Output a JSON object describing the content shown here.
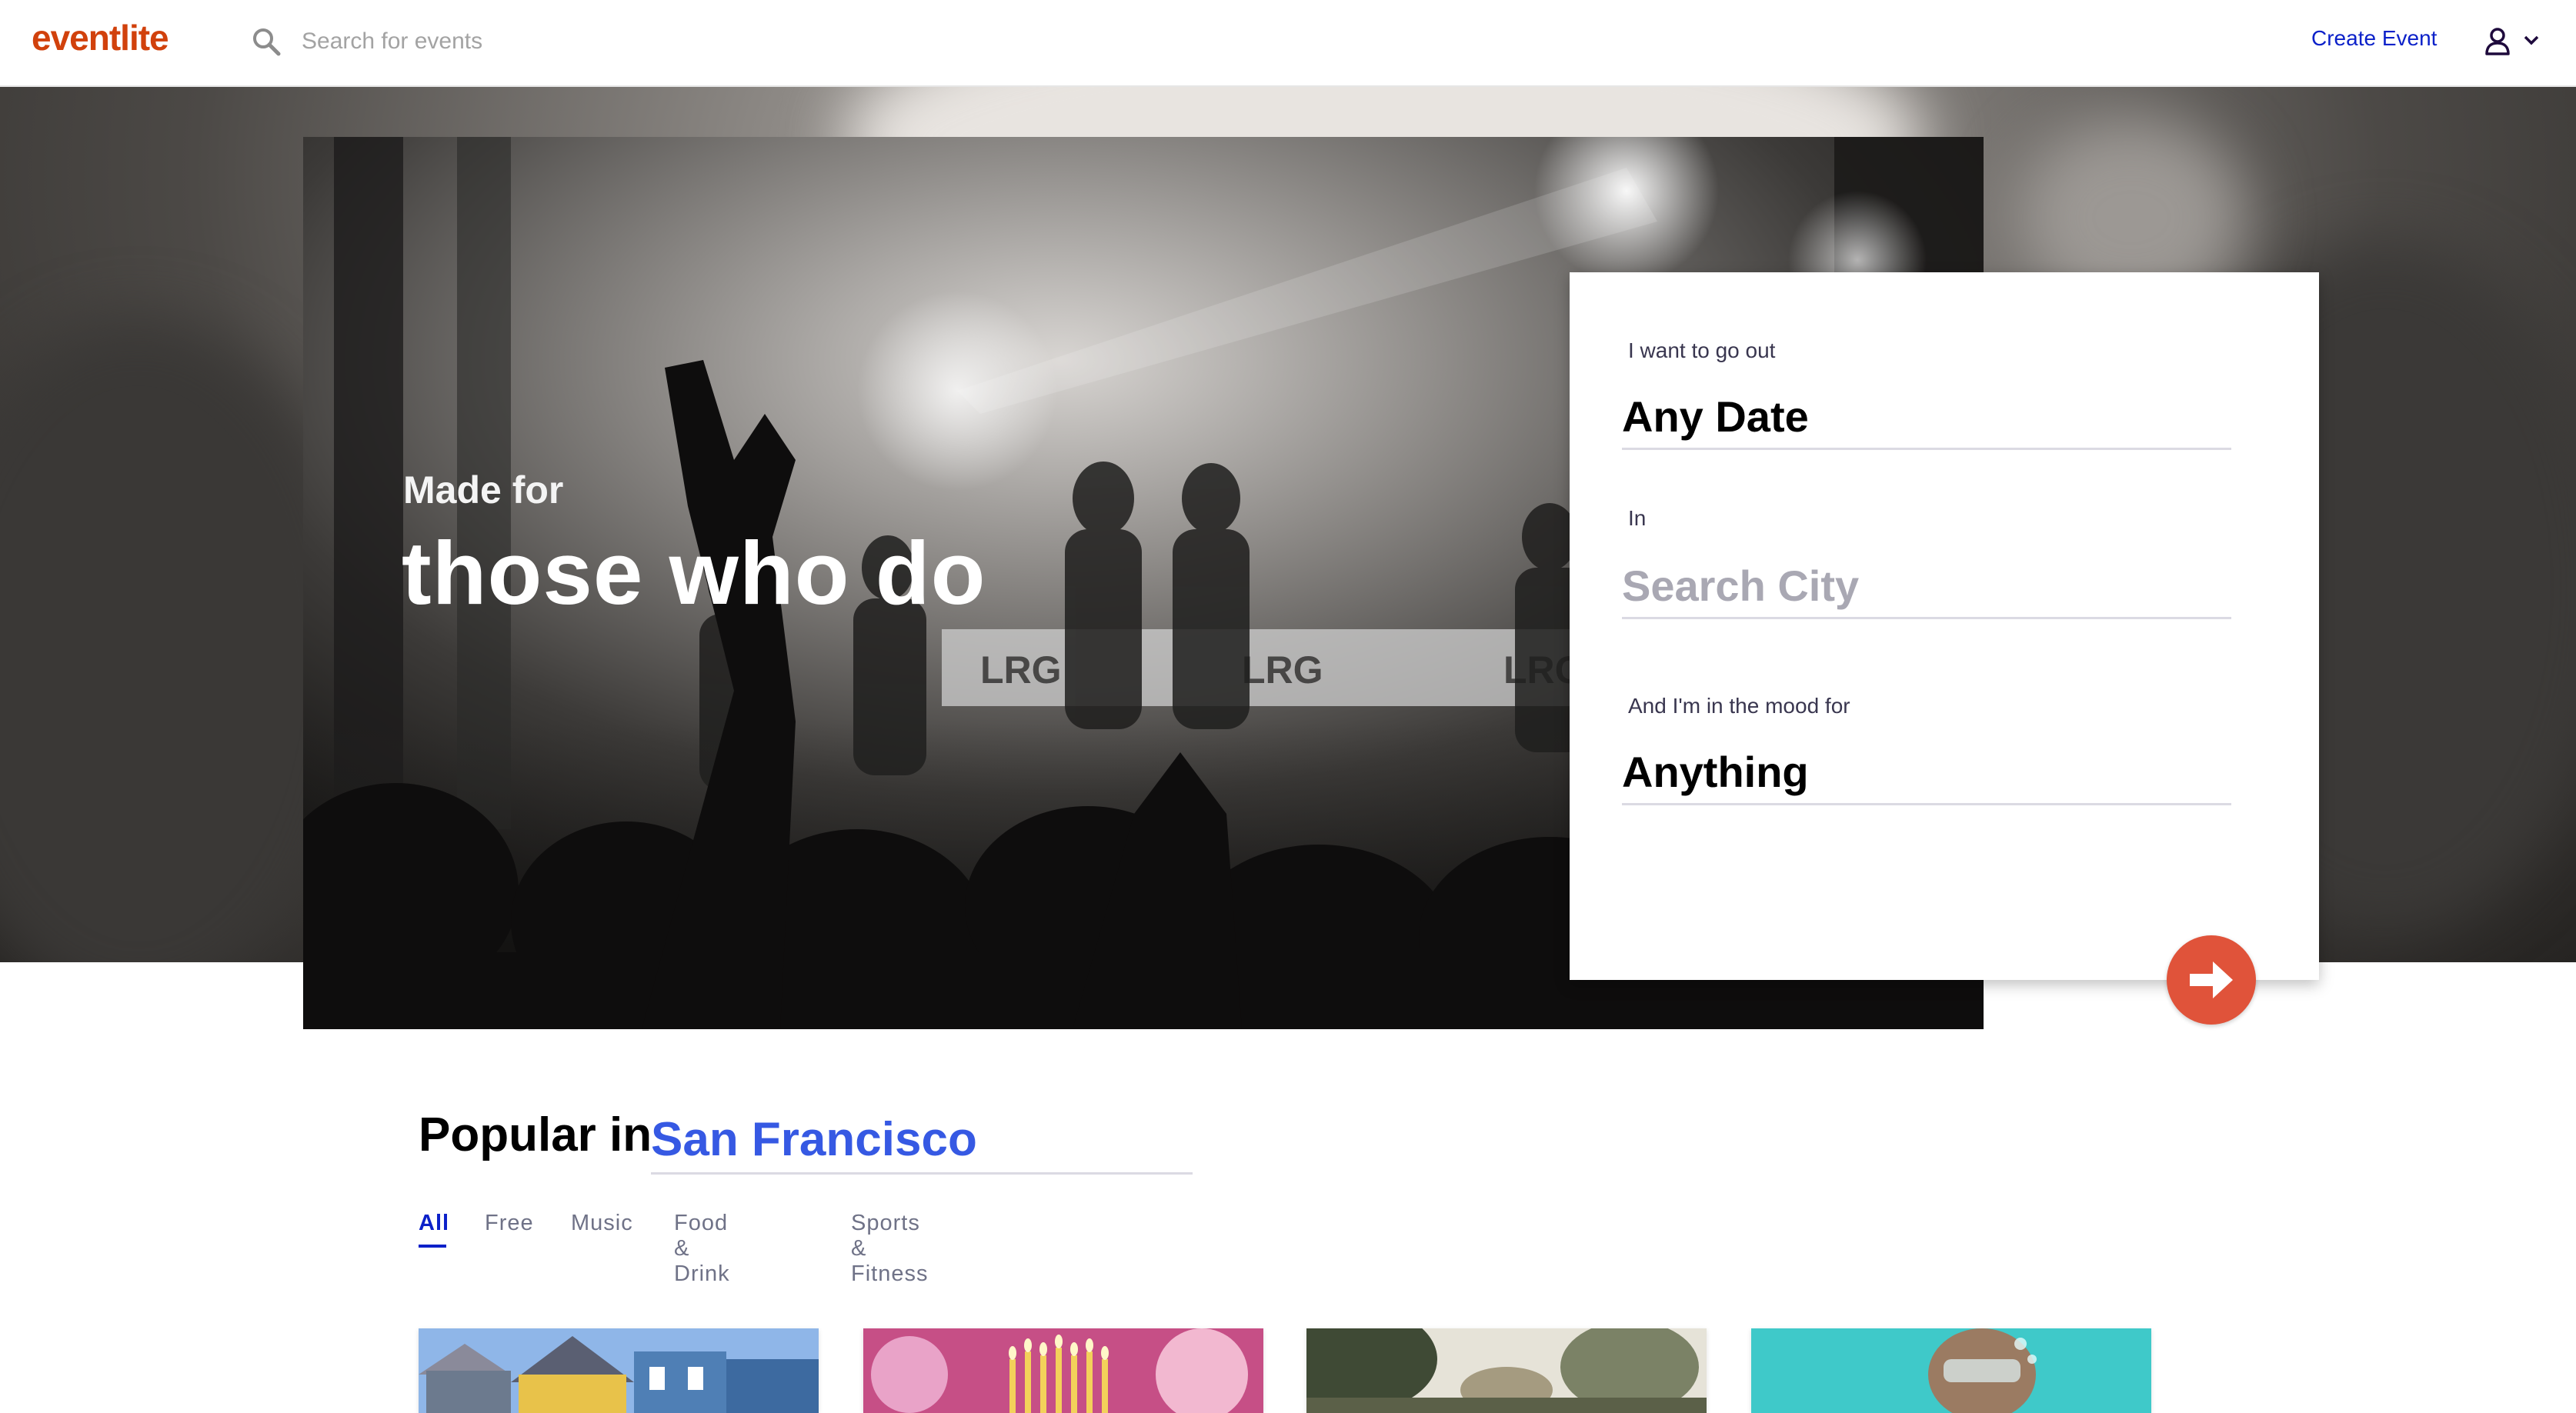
{
  "header": {
    "logo": "eventlite",
    "search_placeholder": "Search for events",
    "create_event_label": "Create Event"
  },
  "hero": {
    "tagline_small": "Made for",
    "tagline_big": "those who do"
  },
  "search_card": {
    "date_label": "I want to go out",
    "date_value": "Any Date",
    "city_label": "In",
    "city_placeholder": "Search City",
    "mood_label": "And I'm in the mood for",
    "mood_value": "Anything"
  },
  "popular": {
    "heading": "Popular in",
    "city": "San Francisco",
    "tabs": [
      "All",
      "Free",
      "Music",
      "Food & Drink",
      "Sports & Fitness"
    ],
    "active_tab": "All"
  },
  "colors": {
    "brand": "#d1410c",
    "link": "#0c21c9",
    "city_accent": "#3659e3",
    "go_button": "#e0533a"
  },
  "icons": [
    "search-icon",
    "user-icon",
    "chevron-down-icon",
    "arrow-right-icon"
  ]
}
